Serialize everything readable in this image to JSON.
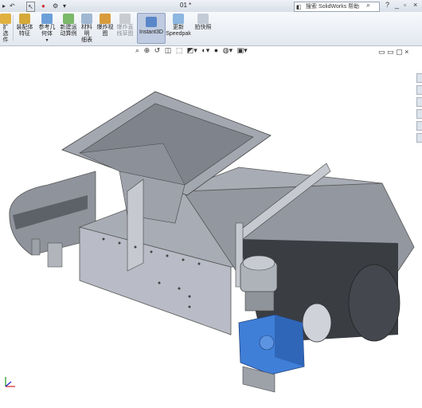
{
  "window": {
    "document_title": "01 *",
    "search_placeholder": "搜索 SolidWorks 帮助",
    "help_label": "?"
  },
  "ribbon": {
    "buttons": [
      {
        "label_l1": "扩",
        "label_l2": "选",
        "label_l3": "件"
      },
      {
        "label_l1": "装配体",
        "label_l2": "特征"
      },
      {
        "label_l1": "参考几",
        "label_l2": "何体"
      },
      {
        "label_l1": "新建运",
        "label_l2": "动算例"
      },
      {
        "label_l1": "材料明",
        "label_l2": "细表"
      },
      {
        "label_l1": "爆炸视",
        "label_l2": "图"
      },
      {
        "label_l1": "爆炸直",
        "label_l2": "线草图"
      },
      {
        "label_l1": "Instant3D"
      },
      {
        "label_l1": "更新",
        "label_l2": "Speedpak"
      },
      {
        "label_l1": "拍快照"
      }
    ]
  },
  "colors": {
    "accent": "#bfcbe0",
    "frame": "#b9bcc6",
    "belt": "#3a3d42",
    "gearbox": "#3f7fd8",
    "motor": "#aeb3ba"
  }
}
